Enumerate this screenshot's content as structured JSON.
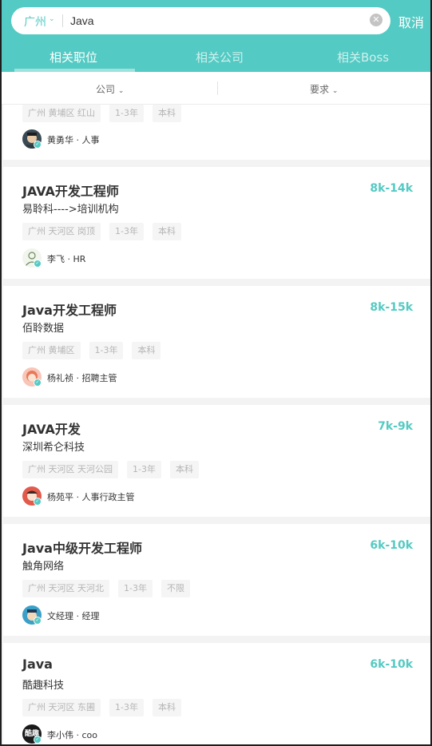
{
  "search": {
    "city": "广州",
    "query": "Java",
    "cancel_label": "取消"
  },
  "tabs": [
    {
      "label": "相关职位"
    },
    {
      "label": "相关公司"
    },
    {
      "label": "相关Boss"
    }
  ],
  "filters": [
    {
      "label": "公司"
    },
    {
      "label": "要求"
    }
  ],
  "colors": {
    "accent": "#53cac3",
    "salary": "#53cac3",
    "tag_bg": "#f5f5f5"
  },
  "jobs": [
    {
      "title": "",
      "salary": "",
      "company": "",
      "tags": [
        "广州 黄埔区 红山",
        "1-3年",
        "本科"
      ],
      "recruiter": "黄勇华 · 人事",
      "avatar_icon": "man-avatar-icon"
    },
    {
      "title": "JAVA开发工程师",
      "salary": "8k-14k",
      "company": "易聆科---->培训机构",
      "tags": [
        "广州 天河区 岗顶",
        "1-3年",
        "本科"
      ],
      "recruiter": "李飞 · HR",
      "avatar_icon": "person-outline-avatar-icon"
    },
    {
      "title": "Java开发工程师",
      "salary": "8k-15k",
      "company": "佰聆数据",
      "tags": [
        "广州 黄埔区",
        "1-3年",
        "本科"
      ],
      "recruiter": "杨礼祯 · 招聘主管",
      "avatar_icon": "woman-avatar-icon"
    },
    {
      "title": "JAVA开发",
      "salary": "7k-9k",
      "company": "深圳希仑科技",
      "tags": [
        "广州 天河区 天河公园",
        "1-3年",
        "本科"
      ],
      "recruiter": "杨苑平 · 人事行政主管",
      "avatar_icon": "woman-red-avatar-icon"
    },
    {
      "title": "Java中级开发工程师",
      "salary": "6k-10k",
      "company": "触角网络",
      "tags": [
        "广州 天河区 天河北",
        "1-3年",
        "不限"
      ],
      "recruiter": "文经理 · 经理",
      "avatar_icon": "cartoon-avatar-icon"
    },
    {
      "title": "Java",
      "salary": "6k-10k",
      "company": "酷趣科技",
      "tags": [
        "广州 天河区 东圃",
        "1-3年",
        "本科"
      ],
      "recruiter": "李小伟 · coo",
      "avatar_icon": "logo-avatar-icon",
      "avatar_text": "酷趣"
    }
  ]
}
